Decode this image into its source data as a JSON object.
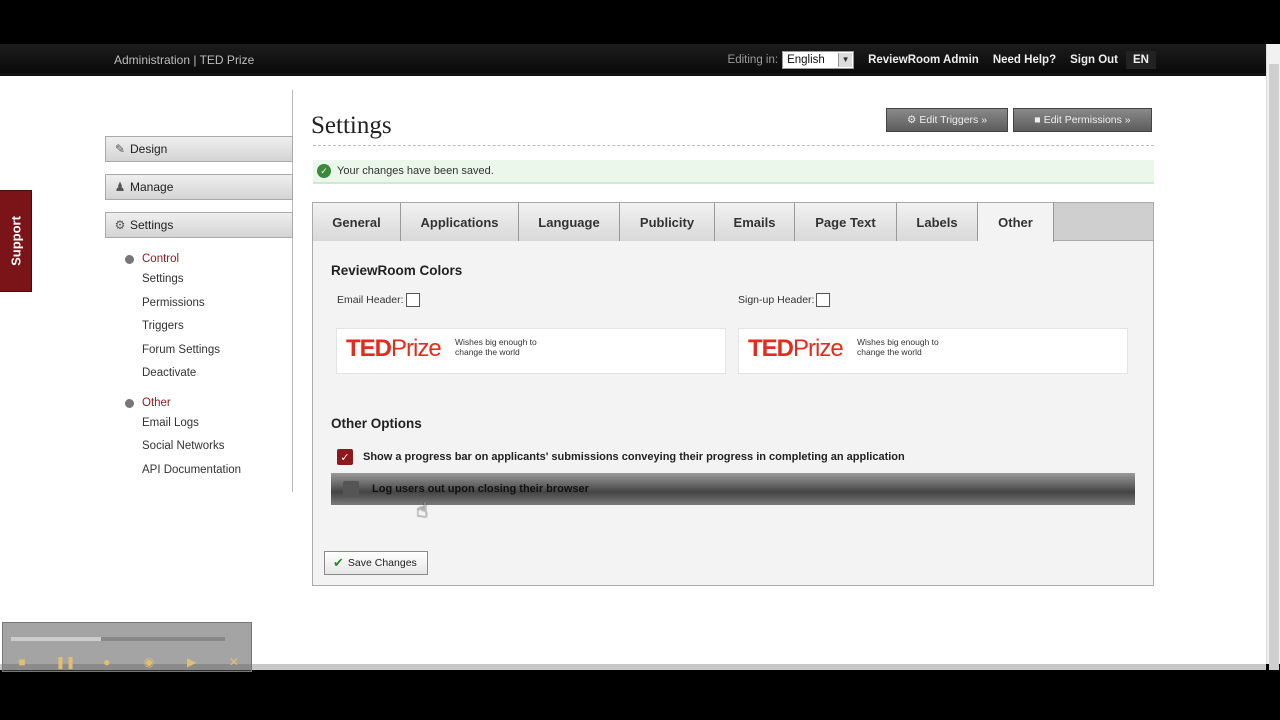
{
  "header": {
    "breadcrumb": "Administration | TED Prize",
    "editing_label": "Editing in:",
    "language": "English",
    "admin_link": "ReviewRoom Admin",
    "help_link": "Need Help?",
    "signout_link": "Sign Out",
    "lang_code": "EN"
  },
  "support": {
    "label": "Support"
  },
  "sidebar": {
    "sections": [
      {
        "label": "Design",
        "icon": "pencil-icon"
      },
      {
        "label": "Manage",
        "icon": "user-icon"
      },
      {
        "label": "Settings",
        "icon": "gear-icon"
      }
    ],
    "control": {
      "heading": "Control",
      "items": [
        "Settings",
        "Permissions",
        "Triggers",
        "Forum Settings",
        "Deactivate"
      ]
    },
    "other": {
      "heading": "Other",
      "items": [
        "Email Logs",
        "Social Networks",
        "API Documentation"
      ]
    }
  },
  "main": {
    "title": "Settings",
    "edit_triggers": "Edit Triggers »",
    "edit_permissions": "Edit Permissions »",
    "notice": "Your changes have been saved.",
    "tabs": [
      "General",
      "Applications",
      "Language",
      "Publicity",
      "Emails",
      "Page Text",
      "Labels",
      "Other"
    ],
    "active_tab": "Other",
    "colors_title": "ReviewRoom Colors",
    "email_header_label": "Email Header:",
    "signup_header_label": "Sign-up Header:",
    "logo": {
      "ted": "TED",
      "prize": "Prize",
      "tagline": "Wishes big enough to change the world"
    },
    "other_options_title": "Other Options",
    "option_progress": "Show a progress bar on applicants' submissions conveying their progress in completing an application",
    "option_logout": "Log users out upon closing their browser",
    "save_label": "Save Changes"
  },
  "colors": {
    "accent": "#8b1a1a",
    "ted_red": "#e62b1e",
    "success": "#3a8a3a"
  }
}
